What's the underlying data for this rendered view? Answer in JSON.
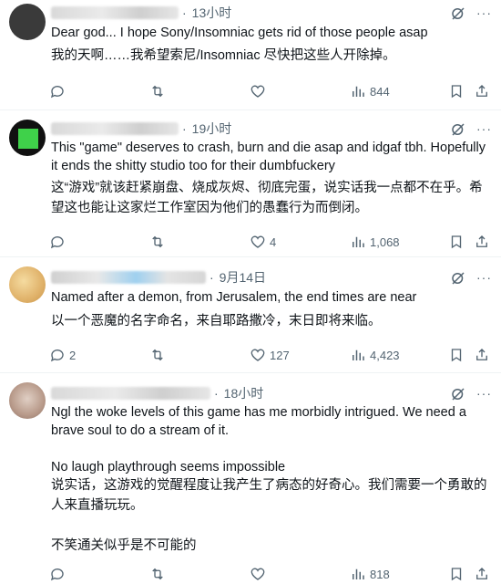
{
  "tweets": [
    {
      "time": "13小时",
      "text": "Dear god... I hope Sony/Insomniac gets rid of those people asap",
      "translation": "我的天啊……我希望索尼/Insomniac 尽快把这些人开除掉。",
      "stats": {
        "replies": "",
        "retweets": "",
        "likes": "",
        "views": "844"
      },
      "avatar_color": "#3a3a3a"
    },
    {
      "time": "19小时",
      "text": "This \"game\" deserves to crash, burn and die asap and idgaf tbh. Hopefully it ends the shitty studio too for their dumbfuckery",
      "translation": "这“游戏”就该赶紧崩盘、烧成灰烬、彻底完蛋，说实话我一点都不在乎。希望这也能让这家烂工作室因为他们的愚蠢行为而倒闭。",
      "stats": {
        "replies": "",
        "retweets": "",
        "likes": "4",
        "views": "1,068"
      },
      "avatar_color": "#1a1a1a"
    },
    {
      "time": "9月14日",
      "text": "Named after a demon, from Jerusalem, the end times are near",
      "translation": "以一个恶魔的名字命名，来自耶路撒冷，末日即将来临。",
      "stats": {
        "replies": "2",
        "retweets": "",
        "likes": "127",
        "views": "4,423"
      },
      "avatar_color": "#e8c27a"
    },
    {
      "time": "18小时",
      "text": "Ngl the woke levels of this game has me morbidly intrigued. We need a brave soul to do a stream of it.\n\nNo laugh playthrough seems impossible",
      "translation": "说实话，这游戏的觉醒程度让我产生了病态的好奇心。我们需要一个勇敢的人来直播玩玩。\n\n不笑通关似乎是不可能的",
      "stats": {
        "replies": "",
        "retweets": "",
        "likes": "",
        "views": "818"
      },
      "avatar_color": "#c9b1a4"
    }
  ],
  "icons": {
    "reply": "reply-icon",
    "retweet": "retweet-icon",
    "like": "heart-icon",
    "views": "views-icon",
    "bookmark": "bookmark-icon",
    "share": "share-icon",
    "grok": "grok-icon"
  }
}
